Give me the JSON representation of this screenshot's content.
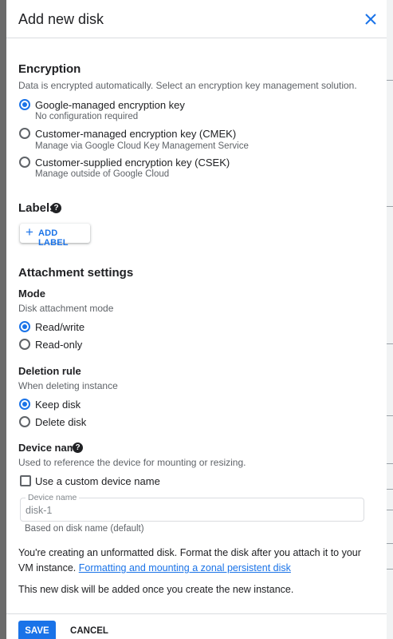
{
  "dialog": {
    "title": "Add new disk",
    "close_icon": "close-icon"
  },
  "encryption": {
    "title": "Encryption",
    "description": "Data is encrypted automatically. Select an encryption key management solution.",
    "options": [
      {
        "label": "Google-managed encryption key",
        "sub": "No configuration required",
        "selected": true
      },
      {
        "label": "Customer-managed encryption key (CMEK)",
        "sub": "Manage via Google Cloud Key Management Service",
        "selected": false
      },
      {
        "label": "Customer-supplied encryption key (CSEK)",
        "sub": "Manage outside of Google Cloud",
        "selected": false
      }
    ]
  },
  "labels": {
    "title": "Labels",
    "add_button": "ADD LABEL"
  },
  "attachment": {
    "title": "Attachment settings",
    "mode": {
      "title": "Mode",
      "description": "Disk attachment mode",
      "options": [
        {
          "label": "Read/write",
          "selected": true
        },
        {
          "label": "Read-only",
          "selected": false
        }
      ]
    },
    "deletion": {
      "title": "Deletion rule",
      "description": "When deleting instance",
      "options": [
        {
          "label": "Keep disk",
          "selected": true
        },
        {
          "label": "Delete disk",
          "selected": false
        }
      ]
    },
    "device": {
      "title": "Device name",
      "description": "Used to reference the device for mounting or resizing.",
      "custom_checkbox_label": "Use a custom device name",
      "custom_checked": false,
      "field_label": "Device name",
      "field_value": "disk-1",
      "helper": "Based on disk name (default)"
    }
  },
  "notice": {
    "text": "You're creating an unformatted disk. Format the disk after you attach it to your VM instance.",
    "link": "Formatting and mounting a zonal persistent disk"
  },
  "footnote": "This new disk will be added once you create the new instance.",
  "footer": {
    "save": "SAVE",
    "cancel": "CANCEL"
  },
  "colors": {
    "accent": "#1a73e8",
    "text": "#202124",
    "secondary": "#5f6368"
  }
}
